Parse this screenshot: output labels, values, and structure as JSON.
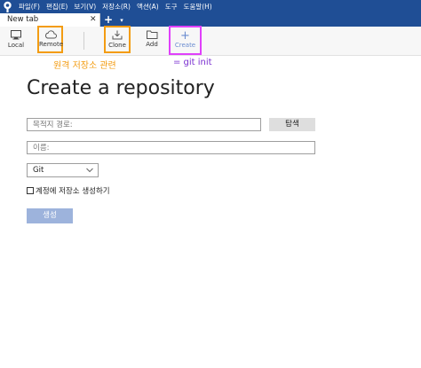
{
  "menubar": {
    "items": [
      "파일(F)",
      "편집(E)",
      "보기(V)",
      "저장소(R)",
      "액션(A)",
      "도구",
      "도움말(H)"
    ]
  },
  "tabs": {
    "active_tab": "New tab",
    "close_glyph": "✕",
    "new_tab_glyph": "+",
    "dropdown_glyph": "▾"
  },
  "toolbar": {
    "local_label": "Local",
    "remote_label": "Remote",
    "clone_label": "Clone",
    "add_label": "Add",
    "create_label": "Create",
    "create_glyph": "+"
  },
  "annotations": {
    "remote_note": "원격 저장소 관련",
    "create_note": "= git init",
    "remote_color": "#f39c12",
    "create_color": "#7a2fd0",
    "remote_box_color": "#f39c12",
    "create_box_color": "#e040fb"
  },
  "form": {
    "title": "Create a repository",
    "destination_placeholder": "목적지 경로:",
    "browse_label": "탐색",
    "name_placeholder": "이름:",
    "vcs_selected": "Git",
    "checkbox_label": "계정에 저장소 생성하기",
    "checkbox_checked": false,
    "submit_label": "생성"
  },
  "colors": {
    "title_bar": "#1f4e95",
    "submit_button": "#9db3dc"
  }
}
